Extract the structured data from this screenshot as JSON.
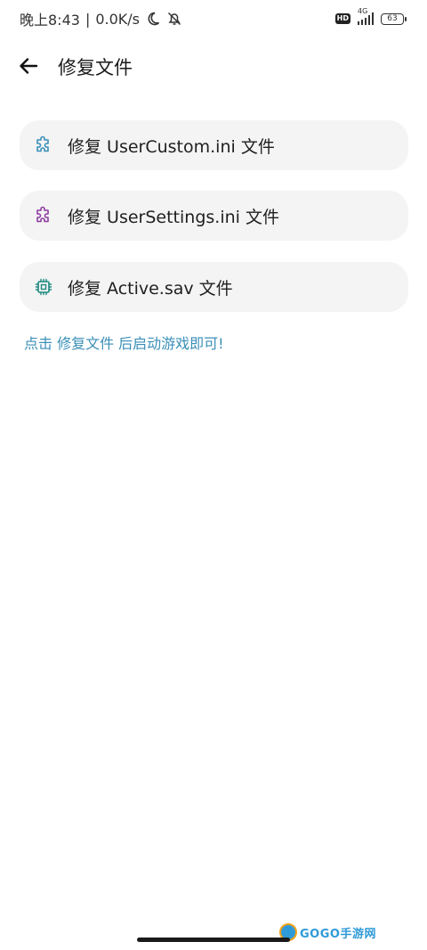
{
  "status_bar": {
    "time_text": "晚上8:43",
    "separator": "|",
    "net_speed": "0.0K/s",
    "network_label": "4G",
    "hd_label": "HD",
    "battery_level": "63"
  },
  "header": {
    "title": "修复文件"
  },
  "cards": [
    {
      "label": "修复 UserCustom.ini 文件",
      "icon": "puzzle-icon",
      "icon_color": "#3a8fb8"
    },
    {
      "label": "修复 UserSettings.ini 文件",
      "icon": "puzzle-icon",
      "icon_color": "#8e3fa0"
    },
    {
      "label": "修复 Active.sav 文件",
      "icon": "chip-icon",
      "icon_color": "#1f8a7f"
    }
  ],
  "hint": "点击 修复文件 后启动游戏即可!",
  "watermark": {
    "text": "GOGO手游网"
  },
  "colors": {
    "background": "#ffffff",
    "card_background": "#f4f4f4",
    "hint": "#3a8fb8"
  }
}
